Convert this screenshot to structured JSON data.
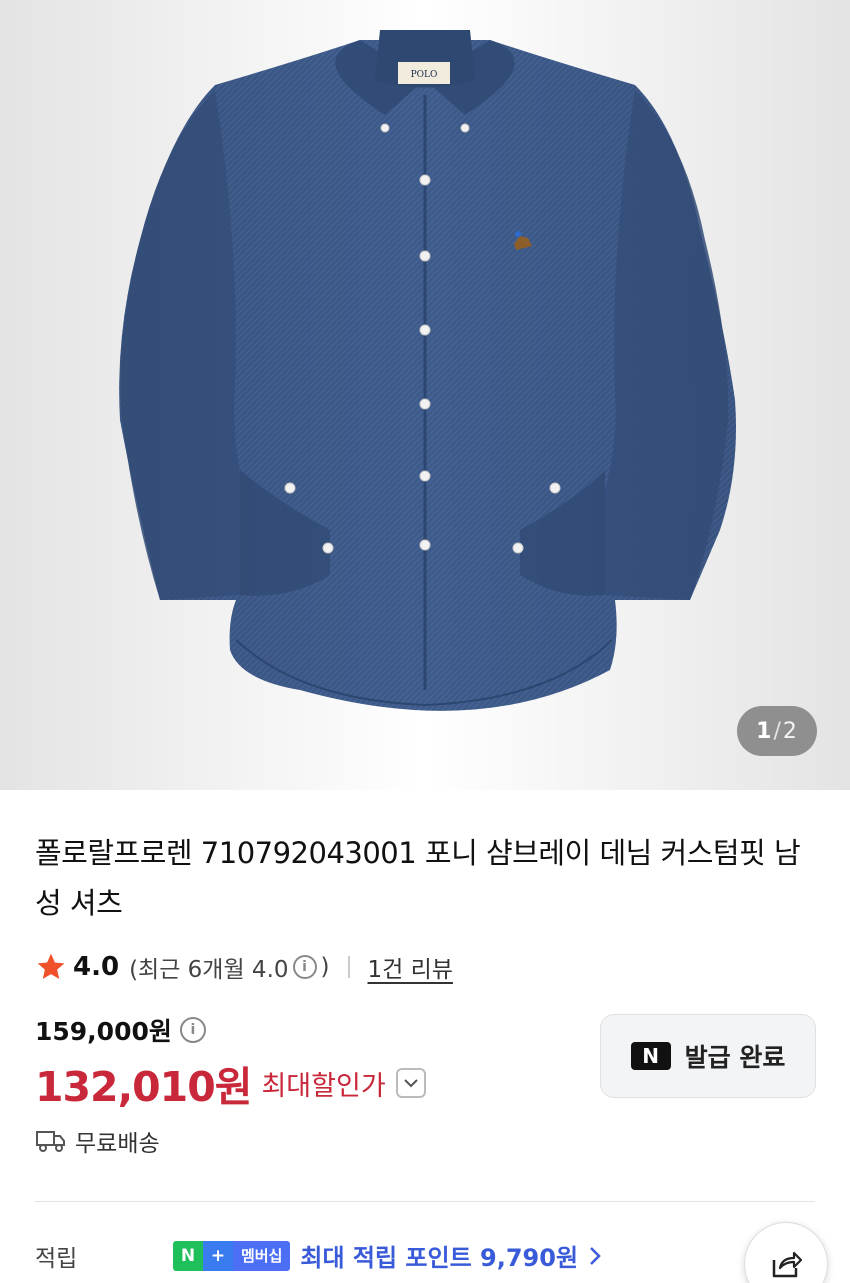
{
  "gallery": {
    "current": "1",
    "separator": "/",
    "total": "2",
    "image_alt": "shirt-photo"
  },
  "product": {
    "title": "폴로랄프로렌 710792043001 포니 샴브레이 데님 커스텀핏 남성 셔츠"
  },
  "rating": {
    "score": "4.0",
    "recent_prefix": "(최근 6개월 4.0",
    "recent_suffix": ")",
    "review_link": "1건 리뷰",
    "info_glyph": "i",
    "star_color": "#f0502a"
  },
  "price": {
    "original": "159,000원",
    "sale": "132,010원",
    "sale_label": "최대할인가",
    "sale_color": "#c8283a"
  },
  "coupon": {
    "badge": "N",
    "label": "발급 완료"
  },
  "shipping": {
    "label": "무료배송",
    "icon": "truck-icon"
  },
  "points": {
    "label": "적립",
    "badge_n": "N",
    "badge_plus": "+",
    "badge_membership": "멤버십",
    "text": "최대 적립 포인트 9,790원",
    "color": "#3a5bd9"
  },
  "share": {
    "icon": "share-icon"
  }
}
